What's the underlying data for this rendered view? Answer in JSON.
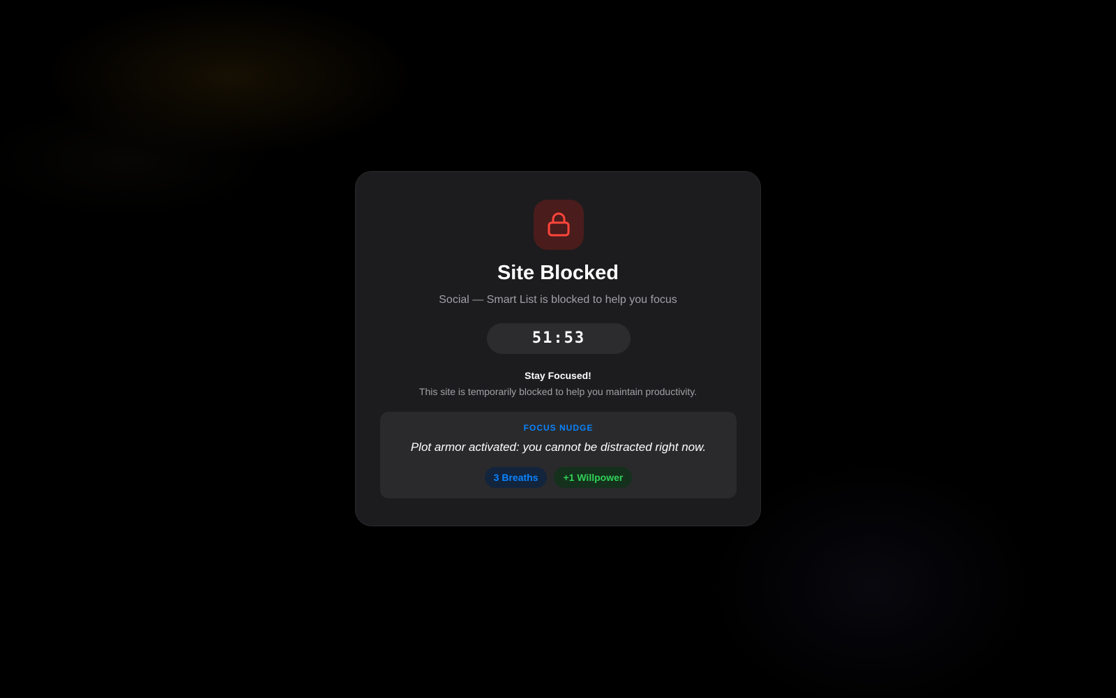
{
  "modal": {
    "icon": "lock-icon",
    "title": "Site Blocked",
    "subtitle": "Social — Smart List is blocked to help you focus",
    "timer": "51:53",
    "stay_title": "Stay Focused!",
    "stay_desc": "This site is temporarily blocked to help you maintain productivity."
  },
  "nudge": {
    "label": "FOCUS NUDGE",
    "quote": "Plot armor activated: you cannot be distracted right now.",
    "badges": [
      {
        "label": "3 Breaths",
        "color": "#0a84ff"
      },
      {
        "label": "+1 Willpower",
        "color": "#30d158"
      }
    ]
  },
  "colors": {
    "accent_red": "#ff453a",
    "accent_blue": "#0a84ff",
    "accent_green": "#30d158",
    "card_bg": "#1c1c1e"
  }
}
